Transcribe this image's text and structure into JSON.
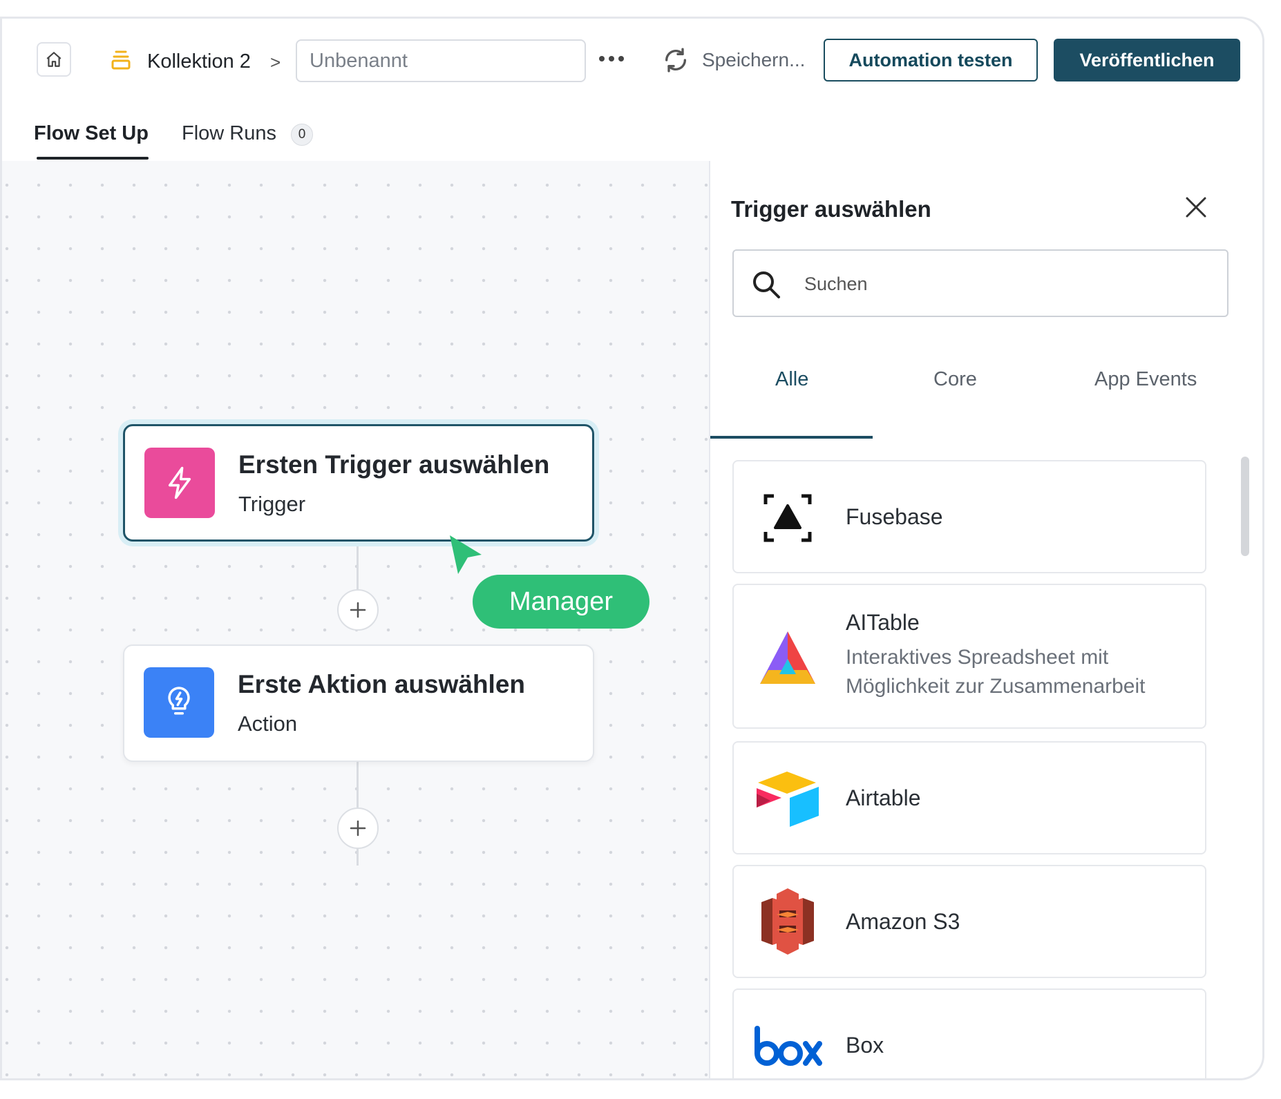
{
  "header": {
    "breadcrumb_collection": "Kollektion 2",
    "breadcrumb_separator": ">",
    "flow_name_placeholder": "Unbenannt",
    "saving_status": "Speichern...",
    "test_button": "Automation testen",
    "publish_button": "Veröffentlichen",
    "icons": {
      "home": "home-icon",
      "collection": "stack-icon",
      "more": "more-dots-icon",
      "sync": "sync-icon"
    }
  },
  "tabs": {
    "setup": "Flow Set Up",
    "runs": "Flow Runs",
    "runs_count": "0",
    "active": "setup"
  },
  "canvas": {
    "trigger_node": {
      "title": "Ersten Trigger auswählen",
      "subtitle": "Trigger",
      "icon": "lightning-icon",
      "color": "#ea4b9b"
    },
    "action_node": {
      "title": "Erste Aktion auswählen",
      "subtitle": "Action",
      "icon": "lightbulb-icon",
      "color": "#3b82f6"
    },
    "collaborator": {
      "label": "Manager",
      "color": "#2fbf77"
    }
  },
  "panel": {
    "title": "Trigger auswählen",
    "search_placeholder": "Suchen",
    "filter_tabs": [
      "Alle",
      "Core",
      "App Events"
    ],
    "active_filter": "Alle",
    "apps": [
      {
        "name": "Fusebase",
        "description": "",
        "icon": "fusebase-logo"
      },
      {
        "name": "AITable",
        "description": "Interaktives Spreadsheet mit Möglichkeit zur Zusammenarbeit",
        "icon": "aitable-logo"
      },
      {
        "name": "Airtable",
        "description": "",
        "icon": "airtable-logo"
      },
      {
        "name": "Amazon S3",
        "description": "",
        "icon": "amazon-s3-logo"
      },
      {
        "name": "Box",
        "description": "",
        "icon": "box-logo"
      }
    ]
  },
  "colors": {
    "primary": "#1c4d62",
    "canvas_bg": "#f7f8fa"
  }
}
